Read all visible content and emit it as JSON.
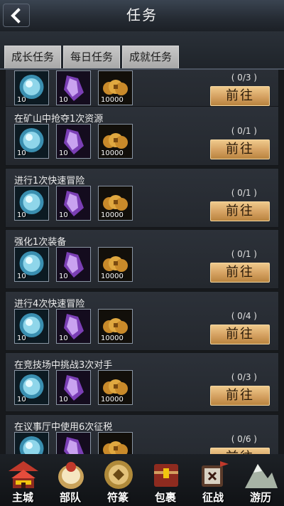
{
  "header": {
    "title": "任务",
    "back_icon": "chevron-left-icon"
  },
  "tabs": [
    {
      "label": "成长任务",
      "selected": true
    },
    {
      "label": "每日任务"
    },
    {
      "label": "成就任务"
    }
  ],
  "reward_items": [
    {
      "icon": "blue-orb-icon",
      "qty": "10"
    },
    {
      "icon": "purple-crystal-icon",
      "qty": "10"
    },
    {
      "icon": "gold-coins-icon",
      "qty": "10000"
    }
  ],
  "tasks": [
    {
      "title": "",
      "progress": "( 0/3 )",
      "button": "前往"
    },
    {
      "title": "在矿山中抢夺1次资源",
      "progress": "( 0/1 )",
      "button": "前往"
    },
    {
      "title": "进行1次快速冒险",
      "progress": "( 0/1 )",
      "button": "前往"
    },
    {
      "title": "强化1次装备",
      "progress": "( 0/1 )",
      "button": "前往"
    },
    {
      "title": "进行4次快速冒险",
      "progress": "( 0/4 )",
      "button": "前往"
    },
    {
      "title": "在竞技场中挑战3次对手",
      "progress": "( 0/3 )",
      "button": "前往"
    },
    {
      "title": "在议事厅中使用6次征税",
      "progress": "( 0/6 )",
      "button": "前往"
    }
  ],
  "bottom_nav": [
    {
      "label": "主城",
      "icon": "palace-icon"
    },
    {
      "label": "部队",
      "icon": "drum-icon"
    },
    {
      "label": "符篆",
      "icon": "talisman-icon"
    },
    {
      "label": "包裹",
      "icon": "chest-icon"
    },
    {
      "label": "征战",
      "icon": "war-flag-icon"
    },
    {
      "label": "游历",
      "icon": "mountain-icon"
    }
  ],
  "colors": {
    "button_gold": "#d4a060",
    "tab_grey": "#b8b8b8",
    "background": "#17191c"
  }
}
